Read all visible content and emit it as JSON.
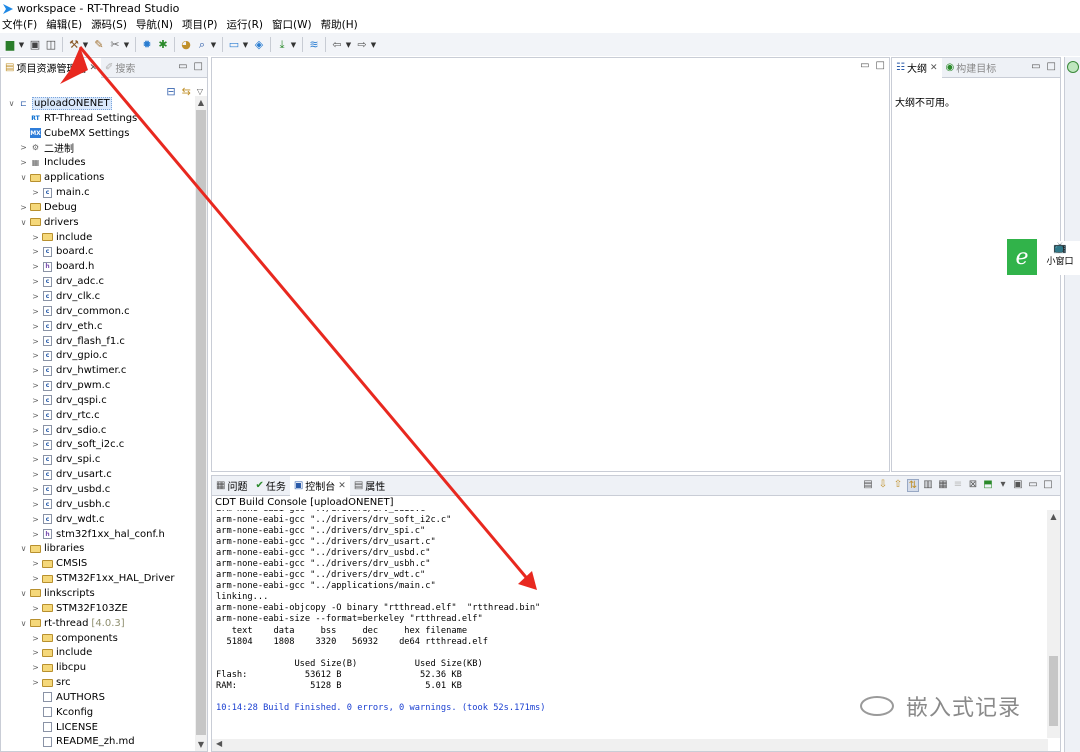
{
  "window": {
    "title": "workspace - RT-Thread Studio"
  },
  "menubar": {
    "items": [
      "文件(F)",
      "编辑(E)",
      "源码(S)",
      "导航(N)",
      "项目(P)",
      "运行(R)",
      "窗口(W)",
      "帮助(H)"
    ]
  },
  "explorer": {
    "tabs": {
      "project": "项目资源管理器",
      "search": "搜索"
    },
    "tree": [
      {
        "label": "uploadONENET",
        "depth": 0,
        "icon": "project-icon",
        "chevron": "down",
        "selected": true
      },
      {
        "label": "RT-Thread Settings",
        "depth": 1,
        "icon": "rt-settings-icon",
        "chevron": ""
      },
      {
        "label": "CubeMX Settings",
        "depth": 1,
        "icon": "cubemx-icon",
        "chevron": ""
      },
      {
        "label": "二进制",
        "depth": 1,
        "icon": "binaries-icon",
        "chevron": "right"
      },
      {
        "label": "Includes",
        "depth": 1,
        "icon": "includes-icon",
        "chevron": "right"
      },
      {
        "label": "applications",
        "depth": 1,
        "icon": "folder-icon",
        "chevron": "down"
      },
      {
        "label": "main.c",
        "depth": 2,
        "icon": "c-file-icon",
        "chevron": "right"
      },
      {
        "label": "Debug",
        "depth": 1,
        "icon": "folder-icon",
        "chevron": "right"
      },
      {
        "label": "drivers",
        "depth": 1,
        "icon": "folder-icon",
        "chevron": "down"
      },
      {
        "label": "include",
        "depth": 2,
        "icon": "folder-icon",
        "chevron": "right"
      },
      {
        "label": "board.c",
        "depth": 2,
        "icon": "c-file-icon",
        "chevron": "right"
      },
      {
        "label": "board.h",
        "depth": 2,
        "icon": "h-file-icon",
        "chevron": "right"
      },
      {
        "label": "drv_adc.c",
        "depth": 2,
        "icon": "c-file-icon",
        "chevron": "right"
      },
      {
        "label": "drv_clk.c",
        "depth": 2,
        "icon": "c-file-icon",
        "chevron": "right"
      },
      {
        "label": "drv_common.c",
        "depth": 2,
        "icon": "c-file-icon",
        "chevron": "right"
      },
      {
        "label": "drv_eth.c",
        "depth": 2,
        "icon": "c-file-icon",
        "chevron": "right"
      },
      {
        "label": "drv_flash_f1.c",
        "depth": 2,
        "icon": "c-file-icon",
        "chevron": "right"
      },
      {
        "label": "drv_gpio.c",
        "depth": 2,
        "icon": "c-file-icon",
        "chevron": "right"
      },
      {
        "label": "drv_hwtimer.c",
        "depth": 2,
        "icon": "c-file-icon",
        "chevron": "right"
      },
      {
        "label": "drv_pwm.c",
        "depth": 2,
        "icon": "c-file-icon",
        "chevron": "right"
      },
      {
        "label": "drv_qspi.c",
        "depth": 2,
        "icon": "c-file-icon",
        "chevron": "right"
      },
      {
        "label": "drv_rtc.c",
        "depth": 2,
        "icon": "c-file-icon",
        "chevron": "right"
      },
      {
        "label": "drv_sdio.c",
        "depth": 2,
        "icon": "c-file-icon",
        "chevron": "right"
      },
      {
        "label": "drv_soft_i2c.c",
        "depth": 2,
        "icon": "c-file-icon",
        "chevron": "right"
      },
      {
        "label": "drv_spi.c",
        "depth": 2,
        "icon": "c-file-icon",
        "chevron": "right"
      },
      {
        "label": "drv_usart.c",
        "depth": 2,
        "icon": "c-file-icon",
        "chevron": "right"
      },
      {
        "label": "drv_usbd.c",
        "depth": 2,
        "icon": "c-file-icon",
        "chevron": "right"
      },
      {
        "label": "drv_usbh.c",
        "depth": 2,
        "icon": "c-file-icon",
        "chevron": "right"
      },
      {
        "label": "drv_wdt.c",
        "depth": 2,
        "icon": "c-file-icon",
        "chevron": "right"
      },
      {
        "label": "stm32f1xx_hal_conf.h",
        "depth": 2,
        "icon": "h-file-icon",
        "chevron": "right"
      },
      {
        "label": "libraries",
        "depth": 1,
        "icon": "folder-icon",
        "chevron": "down"
      },
      {
        "label": "CMSIS",
        "depth": 2,
        "icon": "folder-icon",
        "chevron": "right"
      },
      {
        "label": "STM32F1xx_HAL_Driver",
        "depth": 2,
        "icon": "folder-icon",
        "chevron": "right"
      },
      {
        "label": "linkscripts",
        "depth": 1,
        "icon": "folder-icon",
        "chevron": "down"
      },
      {
        "label": "STM32F103ZE",
        "depth": 2,
        "icon": "folder-icon",
        "chevron": "right"
      },
      {
        "label": "rt-thread",
        "depth": 1,
        "icon": "folder-icon",
        "chevron": "down",
        "version": "[4.0.3]"
      },
      {
        "label": "components",
        "depth": 2,
        "icon": "folder-icon",
        "chevron": "right"
      },
      {
        "label": "include",
        "depth": 2,
        "icon": "folder-icon",
        "chevron": "right"
      },
      {
        "label": "libcpu",
        "depth": 2,
        "icon": "folder-icon",
        "chevron": "right"
      },
      {
        "label": "src",
        "depth": 2,
        "icon": "folder-icon",
        "chevron": "right"
      },
      {
        "label": "AUTHORS",
        "depth": 2,
        "icon": "text-file-icon",
        "chevron": ""
      },
      {
        "label": "Kconfig",
        "depth": 2,
        "icon": "text-file-icon",
        "chevron": ""
      },
      {
        "label": "LICENSE",
        "depth": 2,
        "icon": "text-file-icon",
        "chevron": ""
      },
      {
        "label": "README_zh.md",
        "depth": 2,
        "icon": "md-file-icon",
        "chevron": ""
      }
    ]
  },
  "outline": {
    "tabs": {
      "outline": "大纲",
      "build_targets": "构建目标"
    },
    "message": "大纲不可用。"
  },
  "float_widget": {
    "label": "小窗口"
  },
  "console": {
    "tabs": {
      "problems": "问题",
      "tasks": "任务",
      "console": "控制台",
      "properties": "属性"
    },
    "header": "CDT Build Console [uploadONENET]",
    "lines": [
      "arm-none-eabi-gcc \"../drivers/drv_sdio.c\"",
      "arm-none-eabi-gcc \"../drivers/drv_soft_i2c.c\"",
      "arm-none-eabi-gcc \"../drivers/drv_spi.c\"",
      "arm-none-eabi-gcc \"../drivers/drv_usart.c\"",
      "arm-none-eabi-gcc \"../drivers/drv_usbd.c\"",
      "arm-none-eabi-gcc \"../drivers/drv_usbh.c\"",
      "arm-none-eabi-gcc \"../drivers/drv_wdt.c\"",
      "arm-none-eabi-gcc \"../applications/main.c\"",
      "linking...",
      "arm-none-eabi-objcopy -O binary \"rtthread.elf\"  \"rtthread.bin\"",
      "arm-none-eabi-size --format=berkeley \"rtthread.elf\"",
      "   text\t   data\t    bss\t    dec\t    hex\tfilename",
      "  51804\t   1808\t   3320\t  56932\t   de64\trtthread.elf",
      "",
      "               Used Size(B)           Used Size(KB)",
      "Flash:           53612 B               52.36 KB",
      "RAM:              5128 B                5.01 KB",
      "",
      "10:14:28 Build Finished. 0 errors, 0 warnings. (took 52s.171ms)"
    ]
  },
  "watermark": {
    "text": "嵌入式记录"
  },
  "colors": {
    "annotation_arrow": "#e8281f",
    "finished_text": "#1a3fd1",
    "float_green": "#31b34a"
  }
}
